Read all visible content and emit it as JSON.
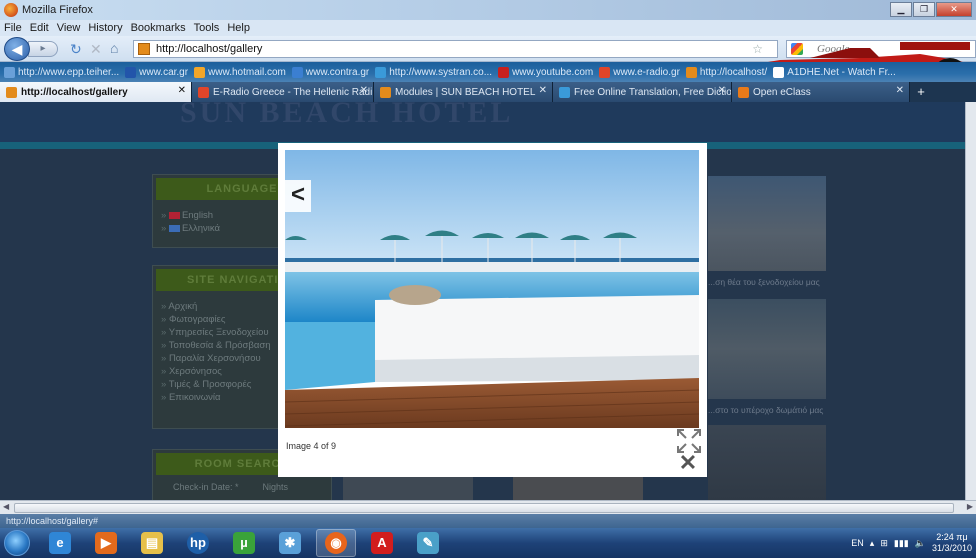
{
  "window": {
    "title": "Mozilla Firefox"
  },
  "menu": [
    "File",
    "Edit",
    "View",
    "History",
    "Bookmarks",
    "Tools",
    "Help"
  ],
  "nav": {
    "url": "http://localhost/gallery",
    "search_placeholder": "Google"
  },
  "bookmarks": [
    {
      "label": "http://www.epp.teiher...",
      "color": "#6aa0d8"
    },
    {
      "label": "www.car.gr",
      "color": "#2255aa"
    },
    {
      "label": "www.hotmail.com",
      "color": "#f2a62a"
    },
    {
      "label": "www.contra.gr",
      "color": "#3b7fd1"
    },
    {
      "label": "http://www.systran.co...",
      "color": "#3a9ad9"
    },
    {
      "label": "www.youtube.com",
      "color": "#c8201e"
    },
    {
      "label": "www.e-radio.gr",
      "color": "#e0452a"
    },
    {
      "label": "http://localhost/",
      "color": "#e38b1c"
    },
    {
      "label": "A1DHE.Net - Watch Fr...",
      "color": "#ffffff"
    }
  ],
  "tabs": [
    {
      "label": "http://localhost/gallery",
      "active": true,
      "color": "#e38b1c"
    },
    {
      "label": "E-Radio Greece - The Hellenic Radi...",
      "active": false,
      "color": "#e0452a"
    },
    {
      "label": "Modules | SUN BEACH HOTEL",
      "active": false,
      "color": "#e38b1c"
    },
    {
      "label": "Free Online Translation, Free Dictio...",
      "active": false,
      "color": "#3a9ad9"
    },
    {
      "label": "Open eClass",
      "active": false,
      "color": "#e87a1a"
    }
  ],
  "page": {
    "ghost_title": "SUN BEACH HOTEL",
    "language_box": {
      "title": "LANGUAGE",
      "items": [
        "English",
        "Ελληνικά"
      ]
    },
    "navigation_box": {
      "title": "SITE NAVIGATION",
      "items": [
        "Αρχική",
        "Φωτογραφίες",
        "Υπηρεσίες Ξενοδοχείου",
        "Τοποθεσία & Πρόσβαση",
        "Παραλία Χερσονήσου",
        "Χερσόνησος",
        "Τιμές & Προσφορές",
        "Επικοινωνία"
      ]
    },
    "room_box": {
      "title": "ROOM SEARCH",
      "checkin_label": "Check-in Date: *",
      "nights_label": "Nights"
    },
    "side_captions": [
      "...ση θέα του ξενοδοχείου μας",
      "...στο το υπέροχο δωμάτιό μας"
    ]
  },
  "lightbox": {
    "caption": "Image 4 of 9",
    "prev_label": "<",
    "close_label": "✕"
  },
  "status": {
    "text": "http://localhost/gallery#"
  },
  "taskbar": {
    "lang": "EN",
    "time": "2:24 πμ",
    "date": "31/3/2010",
    "items": [
      {
        "name": "ie",
        "glyph": "e",
        "color": "#2f86d6"
      },
      {
        "name": "media",
        "glyph": "▶",
        "color": "#e36a1c"
      },
      {
        "name": "explorer",
        "glyph": "▤",
        "color": "#e6c04a"
      },
      {
        "name": "hp",
        "glyph": "hp",
        "color": "#1e5fa8"
      },
      {
        "name": "utorrent",
        "glyph": "µ",
        "color": "#3aa33a"
      },
      {
        "name": "network",
        "glyph": "✱",
        "color": "#5aa0d8"
      },
      {
        "name": "firefox",
        "glyph": "◉",
        "color": "#e8651c"
      },
      {
        "name": "acrobat",
        "glyph": "A",
        "color": "#d21d1d"
      },
      {
        "name": "paint",
        "glyph": "✎",
        "color": "#4aa0c8"
      }
    ]
  }
}
